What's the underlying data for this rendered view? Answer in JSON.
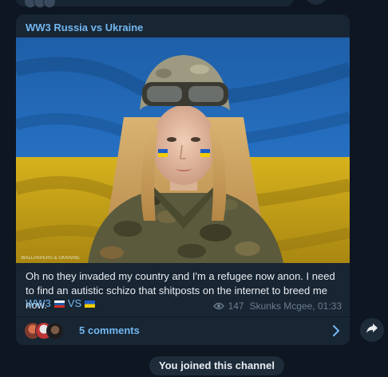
{
  "post": {
    "channel_name": "WW3 Russia vs Ukraine",
    "image_watermark": "WALLPAPERS & UKRAINE",
    "text": "Oh no they invaded my country and I'm a refugee now anon. I need to find an autistic schizo that shitposts on the internet to breed me now.",
    "tag_left": "WW3",
    "tag_vs": "VS",
    "views": "147",
    "author_time": "Skunks Mcgee, 01:33"
  },
  "comments": {
    "label": "5 comments",
    "avatar_count": 3
  },
  "service": {
    "joined_label": "You joined this channel"
  },
  "icons": {
    "views": "eye-icon",
    "comments_open": "chevron-right-icon",
    "share": "share-arrow-icon",
    "flag_russia": "russia-flag-icon",
    "flag_ukraine": "ukraine-flag-icon"
  },
  "colors": {
    "background": "#0e1621",
    "bubble": "#182533",
    "accent": "#72b7f0",
    "meta": "#6c7b8c"
  }
}
